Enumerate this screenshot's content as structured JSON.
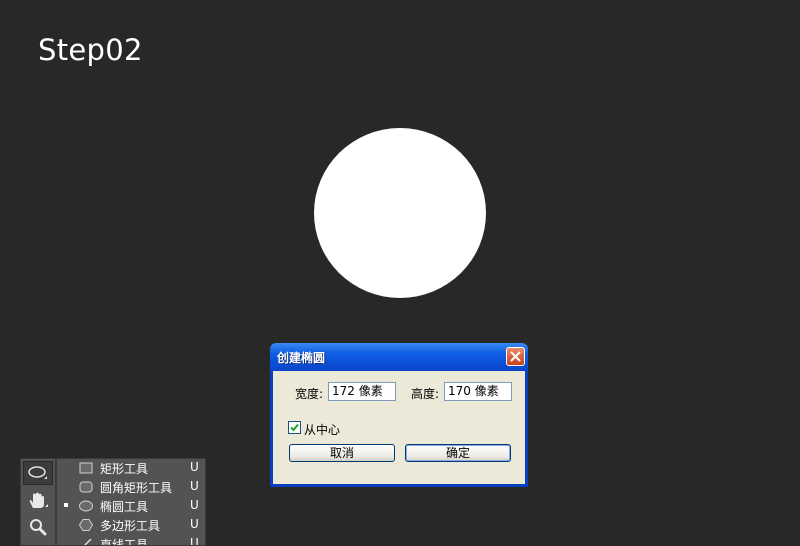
{
  "step_title": "Step02",
  "dialog": {
    "title": "创建椭圆",
    "width_label": "宽度:",
    "width_value": "172 像素",
    "height_label": "高度:",
    "height_value": "170 像素",
    "from_center_label": "从中心",
    "from_center_checked": true,
    "cancel_label": "取消",
    "ok_label": "确定"
  },
  "tools": [
    {
      "icon": "ellipse-tool-icon",
      "active": true
    },
    {
      "icon": "hand-tool-icon",
      "active": false
    },
    {
      "icon": "zoom-tool-icon",
      "active": false
    }
  ],
  "flyout": {
    "items": [
      {
        "label": "矩形工具",
        "shortcut": "U",
        "icon": "rectangle-icon",
        "selected": false
      },
      {
        "label": "圆角矩形工具",
        "shortcut": "U",
        "icon": "rounded-rectangle-icon",
        "selected": false
      },
      {
        "label": "椭圆工具",
        "shortcut": "U",
        "icon": "ellipse-icon",
        "selected": true
      },
      {
        "label": "多边形工具",
        "shortcut": "U",
        "icon": "polygon-icon",
        "selected": false
      },
      {
        "label": "直线工具",
        "shortcut": "U",
        "icon": "line-icon",
        "selected": false
      }
    ]
  },
  "colors": {
    "canvas_bg": "#282828",
    "shape_fill": "#ffffff",
    "dialog_title_bar": "#0a50d8",
    "dialog_body": "#ece9d8",
    "close_button": "#c8401e",
    "panel_bg": "#535353"
  }
}
